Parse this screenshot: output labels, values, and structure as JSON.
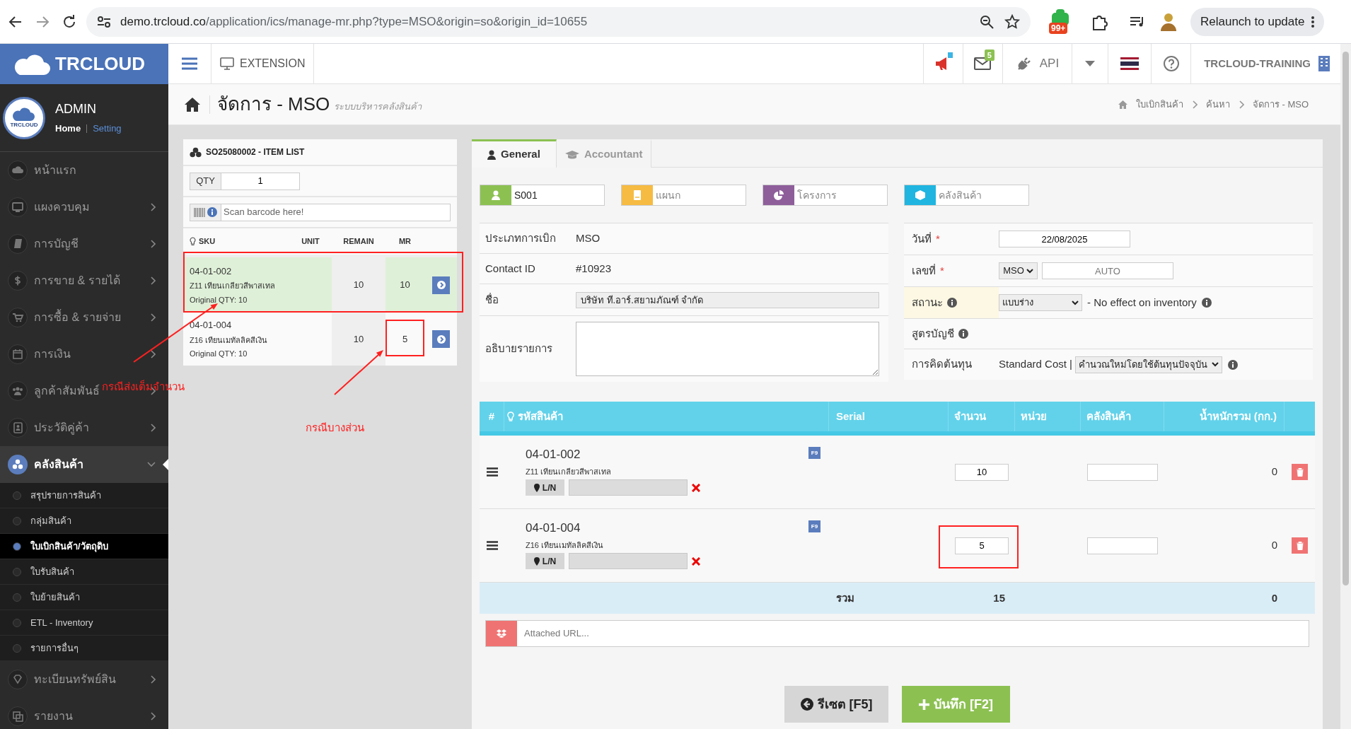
{
  "browser": {
    "url_host": "demo.trcloud.co",
    "url_path": "/application/ics/manage-mr.php?type=MSO&origin=so&origin_id=10655",
    "extension_badge": "99+",
    "relaunch": "Relaunch to update"
  },
  "app_header": {
    "brand": "TRCLOUD",
    "extension": "EXTENSION",
    "mail_count": "5",
    "api": "API",
    "company": "TRCLOUD-TRAINING"
  },
  "user": {
    "logo": "TRCLOUD",
    "name": "ADMIN",
    "home": "Home",
    "setting": "Setting"
  },
  "sidebar": {
    "items": [
      {
        "label": "หน้าแรก",
        "expandable": false,
        "expanded": false
      },
      {
        "label": "แผงควบคุม",
        "expandable": true,
        "expanded": false
      },
      {
        "label": "การบัญชี",
        "expandable": true,
        "expanded": false
      },
      {
        "label": "การขาย & รายได้",
        "expandable": true,
        "expanded": false
      },
      {
        "label": "การซื้อ & รายจ่าย",
        "expandable": true,
        "expanded": false
      },
      {
        "label": "การเงิน",
        "expandable": true,
        "expanded": false
      },
      {
        "label": "ลูกค้าสัมพันธ์",
        "expandable": true,
        "expanded": false
      },
      {
        "label": "ประวัติคู่ค้า",
        "expandable": true,
        "expanded": false
      },
      {
        "label": "คลังสินค้า",
        "expandable": true,
        "expanded": true,
        "children": [
          {
            "label": "สรุปรายการสินค้า",
            "selected": false
          },
          {
            "label": "กลุ่มสินค้า",
            "selected": false
          },
          {
            "label": "ใบเบิกสินค้า/วัตถุดิบ",
            "selected": true
          },
          {
            "label": "ใบรับสินค้า",
            "selected": false
          },
          {
            "label": "ใบย้ายสินค้า",
            "selected": false
          },
          {
            "label": "ETL - Inventory",
            "selected": false
          },
          {
            "label": "รายการอื่นๆ",
            "selected": false
          }
        ]
      },
      {
        "label": "ทะเบียนทรัพย์สิน",
        "expandable": true,
        "expanded": false
      },
      {
        "label": "รายงาน",
        "expandable": true,
        "expanded": false
      }
    ]
  },
  "page": {
    "title": "จัดการ - MSO",
    "subtitle": "ระบบบริหารคลังสินค้า",
    "breadcrumb": [
      "ใบเบิกสินค้า",
      "ค้นหา",
      "จัดการ - MSO"
    ]
  },
  "item_list": {
    "title": "SO25080002 - ITEM LIST",
    "qty_label": "QTY",
    "qty_value": "1",
    "scan_placeholder": "Scan barcode here!",
    "columns": [
      "SKU",
      "UNIT",
      "REMAIN",
      "MR"
    ],
    "rows": [
      {
        "sku": "04-01-002",
        "name": "Z11 เทียนเกลียวสีพาสเทล",
        "original": "Original QTY: 10",
        "remain": "10",
        "mr": "10",
        "fulfilled": true
      },
      {
        "sku": "04-01-004",
        "name": "Z16 เทียนเมทัลลิคสีเงิน",
        "original": "Original QTY: 10",
        "remain": "10",
        "mr": "5",
        "fulfilled": false
      }
    ]
  },
  "tabs": [
    {
      "label": "General",
      "selected": true
    },
    {
      "label": "Accountant",
      "selected": false
    }
  ],
  "tags": [
    {
      "value": "S001",
      "color": "#8cc152"
    },
    {
      "placeholder": "แผนก",
      "color": "#f6bb42"
    },
    {
      "placeholder": "โครงการ",
      "color": "#8e5e9b"
    },
    {
      "placeholder": "คลังสินค้า",
      "color": "#1fb5e0"
    }
  ],
  "form_left": [
    {
      "kind": "text",
      "label": "ประเภทการเบิก",
      "value": "MSO"
    },
    {
      "kind": "text",
      "label": "Contact ID",
      "value": "#10923"
    },
    {
      "kind": "field",
      "label": "ชื่อ",
      "value": "บริษัท ที.อาร์.สยามภัณฑ์ จำกัด"
    },
    {
      "kind": "textarea",
      "label": "อธิบายรายการ"
    }
  ],
  "form_right": [
    {
      "kind": "date",
      "label": "วันที่",
      "required_mark": "*",
      "value": "22/08/2025"
    },
    {
      "kind": "number",
      "label": "เลขที่",
      "required_mark": "*",
      "prefix": "MSO",
      "placeholder": "AUTO"
    },
    {
      "kind": "status",
      "label": "สถานะ",
      "value": "แบบร่าง",
      "note": "- No effect on inventory"
    },
    {
      "kind": "info",
      "label": "สูตรบัญชี"
    },
    {
      "kind": "cost",
      "label": "การคิดต้นทุน",
      "method": "Standard Cost |",
      "value": "คำนวณใหม่โดยใช้ต้นทุนปัจจุบัน"
    }
  ],
  "table": {
    "columns": [
      "#",
      "รหัสสินค้า",
      "Serial",
      "จำนวน",
      "หน่วย",
      "คลังสินค้า",
      "น้ำหนักรวม (กก.)"
    ],
    "rows": [
      {
        "code": "04-01-002",
        "name": "Z11 เทียนเกลียวสีพาสเทล",
        "key": "F9",
        "lot_label": "L/N",
        "qty": "10",
        "weight": "0"
      },
      {
        "code": "04-01-004",
        "name": "Z16 เทียนเมทัลลิคสีเงิน",
        "key": "F9",
        "lot_label": "L/N",
        "qty": "5",
        "weight": "0"
      }
    ],
    "total": {
      "label": "รวม",
      "qty": "15",
      "weight": "0"
    },
    "attach_placeholder": "Attached URL..."
  },
  "buttons": [
    {
      "label": "รีเซต [F5]",
      "kind": "reset"
    },
    {
      "label": "บันทึก [F2]",
      "kind": "save"
    }
  ],
  "annotations": [
    {
      "text": "กรณีส่งเต็มจำนวน"
    },
    {
      "text": "กรณีบางส่วน"
    }
  ]
}
